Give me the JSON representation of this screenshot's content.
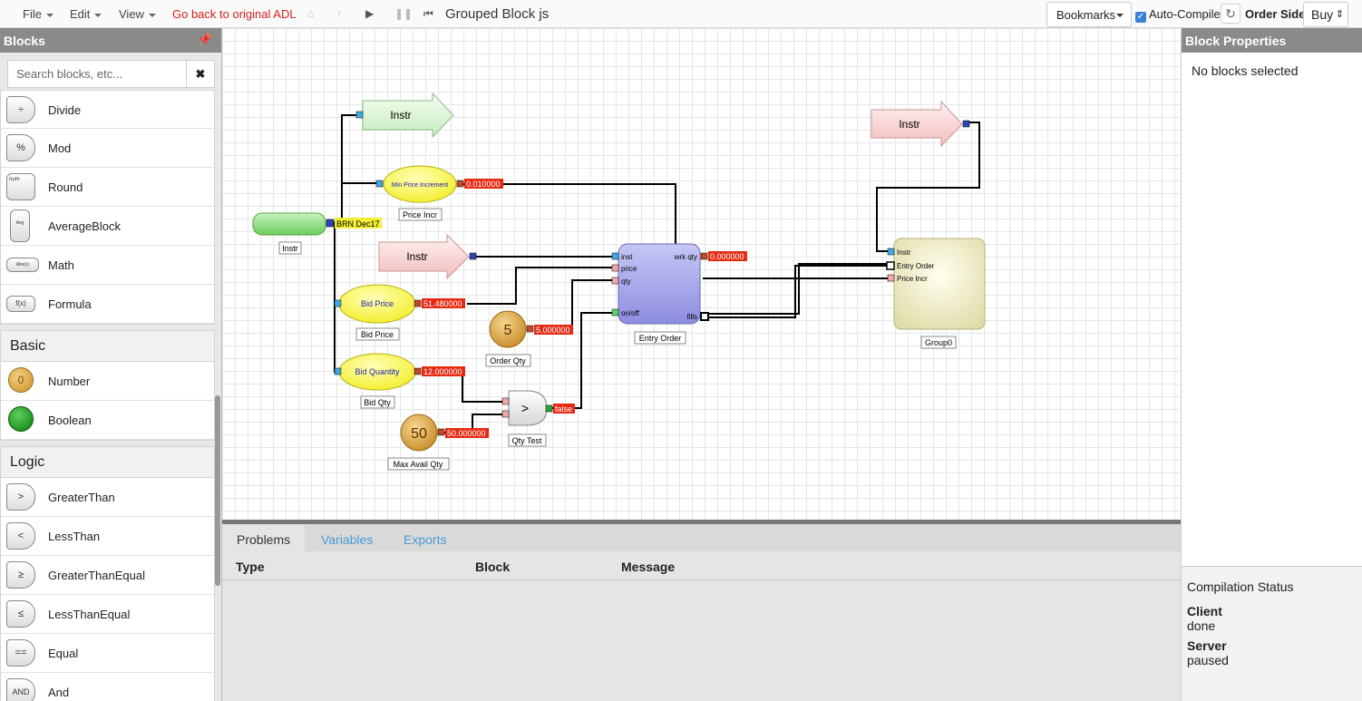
{
  "menu": {
    "file": "File",
    "edit": "Edit",
    "view": "View",
    "back_link": "Go back to original ADL"
  },
  "document_title": "Grouped Block js",
  "toolbar": {
    "bookmarks": "Bookmarks",
    "auto_compile": "Auto-Compile",
    "auto_compile_checked": true,
    "order_side_label": "Order Side",
    "order_side_value": "Buy"
  },
  "left_panel": {
    "title": "Blocks",
    "search_placeholder": "Search blocks, etc...",
    "math_items": [
      {
        "label": "Divide",
        "icon": "÷"
      },
      {
        "label": "Mod",
        "icon": "%"
      },
      {
        "label": "Round",
        "icon": "num"
      },
      {
        "label": "AverageBlock",
        "icon": "Avg"
      },
      {
        "label": "Math",
        "icon": "Abs(x)"
      },
      {
        "label": "Formula",
        "icon": "f(x)"
      }
    ],
    "basic": {
      "title": "Basic",
      "items": [
        {
          "label": "Number",
          "icon": "0"
        },
        {
          "label": "Boolean",
          "icon": ""
        }
      ]
    },
    "logic": {
      "title": "Logic",
      "items": [
        {
          "label": "GreaterThan",
          "icon": ">"
        },
        {
          "label": "LessThan",
          "icon": "<"
        },
        {
          "label": "GreaterThanEqual",
          "icon": "≥"
        },
        {
          "label": "LessThanEqual",
          "icon": "≤"
        },
        {
          "label": "Equal",
          "icon": "=="
        },
        {
          "label": "And",
          "icon": "AND"
        }
      ]
    }
  },
  "canvas": {
    "instr_source": {
      "caption": "Instr",
      "output_label": "BRN Dec17"
    },
    "instr_arrow_top": "Instr",
    "instr_arrow_mid": "Instr",
    "instr_arrow_right": "Instr",
    "min_price": {
      "text": "Min Price Increment",
      "value": "0.010000",
      "caption": "Price Incr"
    },
    "bid_price": {
      "text": "Bid Price",
      "value": "51.480000",
      "caption": "Bid Price"
    },
    "bid_quantity": {
      "text": "Bid Quantity",
      "value": "12.000000",
      "caption": "Bid Qty"
    },
    "order_qty": {
      "number": "5",
      "value": "5.000000",
      "caption": "Order Qty"
    },
    "max_avail": {
      "number": "50",
      "value": "50.000000",
      "caption": "Max Avail Qty"
    },
    "qty_test": {
      "symbol": ">",
      "value": "false",
      "caption": "Qty Test"
    },
    "entry_order": {
      "ports_in": [
        "inst",
        "price",
        "qty",
        "on/off"
      ],
      "port_wrk": "wrk qty",
      "wrk_value": "0.000000",
      "port_fills": "fills",
      "caption": "Entry Order"
    },
    "group": {
      "ports_in": [
        "Instr",
        "Entry Order",
        "Price Incr"
      ],
      "caption": "Group0"
    }
  },
  "bottom_panel": {
    "tabs": [
      "Problems",
      "Variables",
      "Exports"
    ],
    "columns": [
      "Type",
      "Block",
      "Message"
    ]
  },
  "right_panel": {
    "title": "Block Properties",
    "no_selection": "No blocks selected",
    "compilation_title": "Compilation Status",
    "client_label": "Client",
    "client_value": "done",
    "server_label": "Server",
    "server_value": "paused"
  }
}
